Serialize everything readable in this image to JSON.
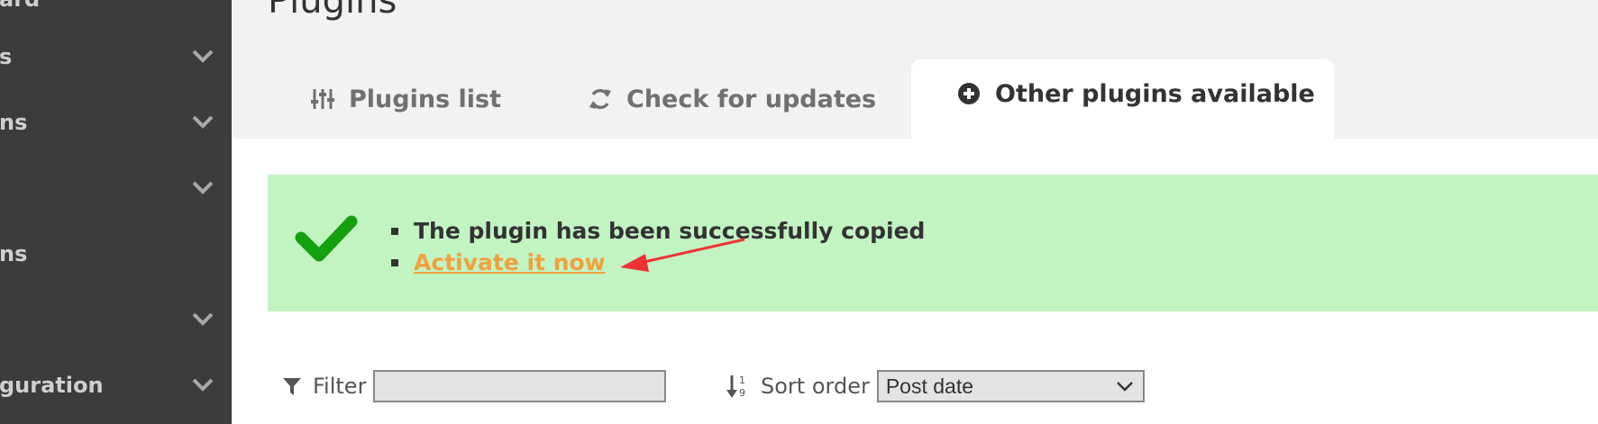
{
  "page": {
    "title": "Plugins"
  },
  "sidebar": {
    "items": [
      {
        "label": "ard",
        "has_chevron": false
      },
      {
        "label": "s",
        "has_chevron": true
      },
      {
        "label": "ns",
        "has_chevron": true
      },
      {
        "label": "",
        "has_chevron": true
      },
      {
        "label": "ns",
        "has_chevron": false
      },
      {
        "label": "",
        "has_chevron": true
      },
      {
        "label": "guration",
        "has_chevron": true
      }
    ]
  },
  "tabs": [
    {
      "id": "plugins-list",
      "label": "Plugins list",
      "icon": "sliders-icon",
      "active": false
    },
    {
      "id": "check-updates",
      "label": "Check for updates",
      "icon": "refresh-icon",
      "active": false
    },
    {
      "id": "other-plugins",
      "label": "Other plugins available",
      "icon": "plus-circle-icon",
      "active": true
    }
  ],
  "notice": {
    "icon": "checkmark-icon",
    "message": "The plugin has been successfully copied",
    "link": "Activate it now"
  },
  "filter": {
    "label": "Filter",
    "value": "",
    "placeholder": ""
  },
  "sort": {
    "label": "Sort order",
    "selected": "Post date"
  },
  "colors": {
    "sidebar_bg": "#3c3c3c",
    "notice_bg": "#c2f4c2",
    "check_green": "#13a10e",
    "link_orange": "#f0a040",
    "annotation_red": "#ee3333"
  }
}
